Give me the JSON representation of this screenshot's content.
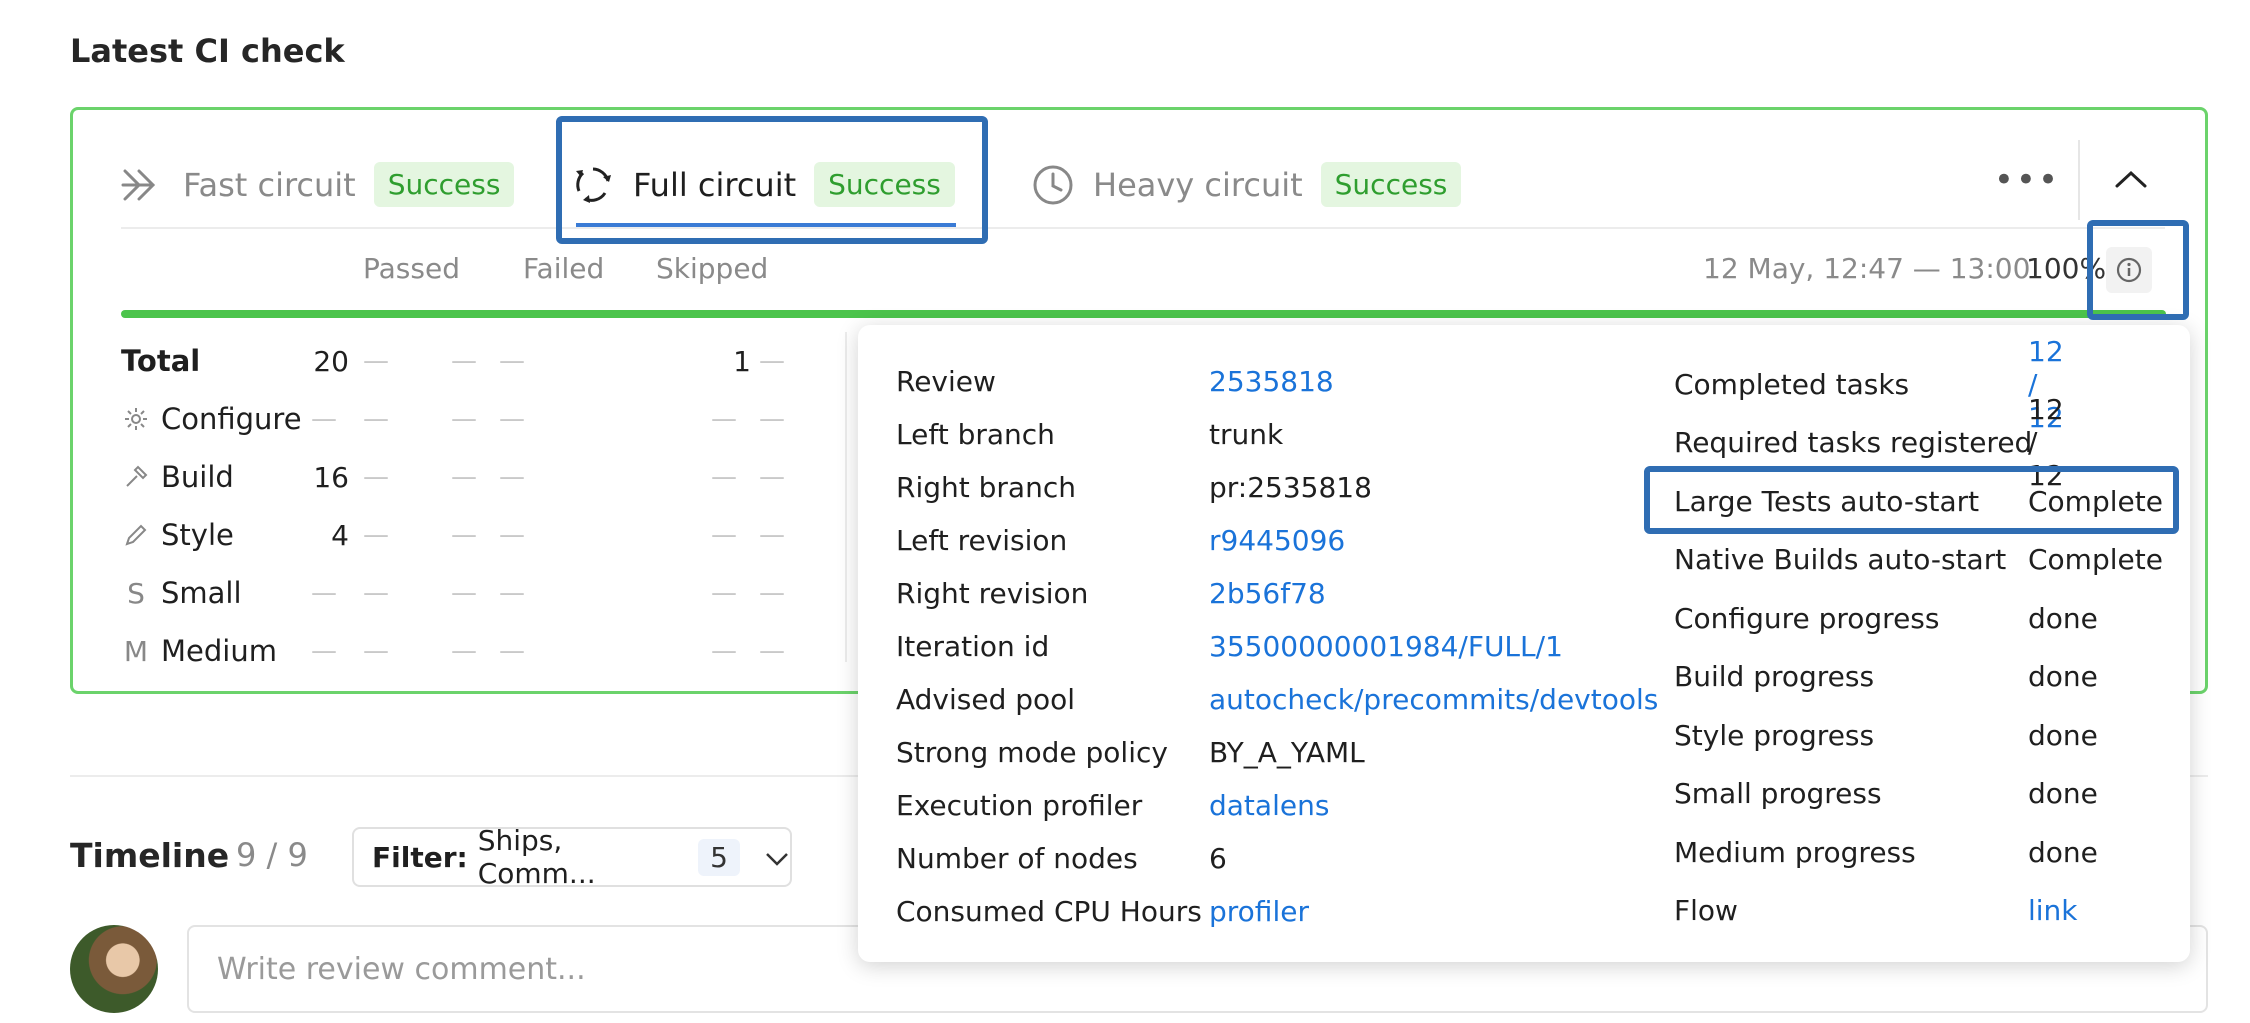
{
  "section_title": "Latest CI check",
  "tabs": [
    {
      "label": "Fast circuit",
      "status": "Success",
      "icon": "double-chevron-right-icon"
    },
    {
      "label": "Full circuit",
      "status": "Success",
      "icon": "refresh-cycle-icon"
    },
    {
      "label": "Heavy circuit",
      "status": "Success",
      "icon": "clock-icon"
    }
  ],
  "stats": {
    "headers": [
      "Passed",
      "Failed",
      "Skipped"
    ],
    "date_range": "12 May, 12:47 — 13:00",
    "percent": "100%",
    "dash": "—",
    "rows": [
      {
        "label": "Total",
        "glyph": "",
        "passed": "20",
        "skipped": "1"
      },
      {
        "label": "Configure",
        "glyph": "⚙",
        "passed": "",
        "skipped": ""
      },
      {
        "label": "Build",
        "glyph": "🔨",
        "passed": "16",
        "skipped": ""
      },
      {
        "label": "Style",
        "glyph": "✎",
        "passed": "4",
        "skipped": ""
      },
      {
        "label": "Small",
        "glyph": "S",
        "passed": "",
        "skipped": ""
      },
      {
        "label": "Medium",
        "glyph": "M",
        "passed": "",
        "skipped": ""
      }
    ]
  },
  "popover": {
    "left": [
      {
        "key": "Review",
        "value": "2535818",
        "link": true
      },
      {
        "key": "Left branch",
        "value": "trunk",
        "link": false
      },
      {
        "key": "Right branch",
        "value": "pr:2535818",
        "link": false
      },
      {
        "key": "Left revision",
        "value": "r9445096",
        "link": true
      },
      {
        "key": "Right revision",
        "value": "2b56f78",
        "link": true
      },
      {
        "key": "Iteration id",
        "value": "35500000001984/FULL/1",
        "link": true
      },
      {
        "key": "Advised pool",
        "value": "autocheck/precommits/devtools",
        "link": true
      },
      {
        "key": "Strong mode policy",
        "value": "BY_A_YAML",
        "link": false
      },
      {
        "key": "Execution profiler",
        "value": "datalens",
        "link": true
      },
      {
        "key": "Number of nodes",
        "value": "6",
        "link": false
      },
      {
        "key": "Consumed CPU Hours",
        "value": "profiler",
        "link": true
      }
    ],
    "right": [
      {
        "key": "Completed tasks",
        "value": "12 / 12",
        "link": true
      },
      {
        "key": "Required tasks registered",
        "value": "12 / 12",
        "link": false
      },
      {
        "key": "Large Tests auto-start",
        "value": "Complete",
        "link": false
      },
      {
        "key": "Native Builds auto-start",
        "value": "Complete",
        "link": false
      },
      {
        "key": "Configure progress",
        "value": "done",
        "link": false
      },
      {
        "key": "Build progress",
        "value": "done",
        "link": false
      },
      {
        "key": "Style progress",
        "value": "done",
        "link": false
      },
      {
        "key": "Small progress",
        "value": "done",
        "link": false
      },
      {
        "key": "Medium progress",
        "value": "done",
        "link": false
      },
      {
        "key": "Flow",
        "value": "link",
        "link": true
      }
    ]
  },
  "timeline": {
    "title": "Timeline",
    "count": "9 / 9",
    "filter_label": "Filter:",
    "filter_value": "Ships, Comm...",
    "filter_count": "5"
  },
  "comment_placeholder": "Write review comment...",
  "colors": {
    "success_border": "#6bd36b",
    "link": "#1a73d9",
    "highlight": "#2f6db3"
  }
}
